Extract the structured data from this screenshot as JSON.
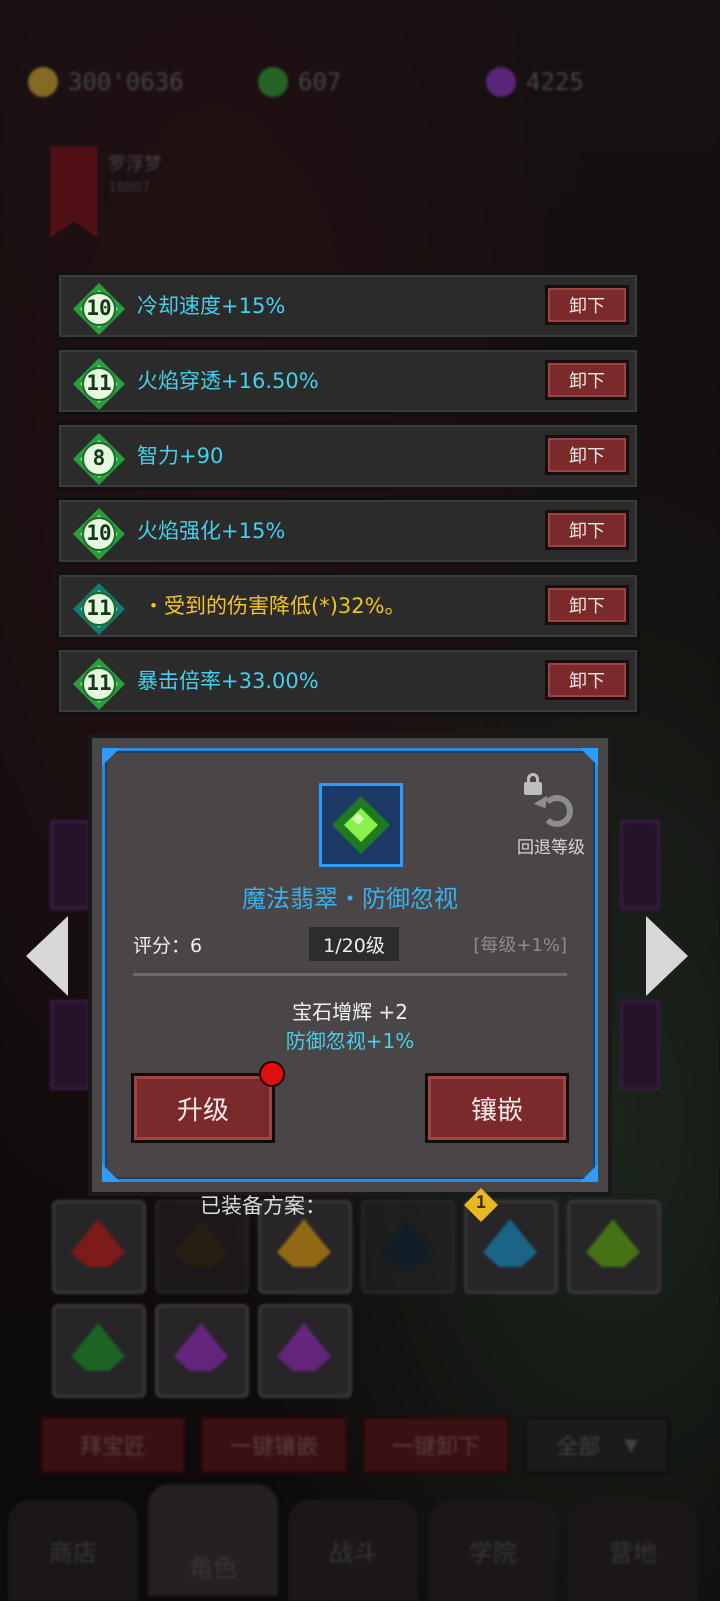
{
  "currencies": [
    {
      "name": "gold-coin-icon",
      "color": "#c9a43a",
      "value": "300'0636"
    },
    {
      "name": "green-crystal-icon",
      "color": "#3a9a3a",
      "value": "607"
    },
    {
      "name": "purple-drop-icon",
      "color": "#8a3ab8",
      "value": "4225"
    }
  ],
  "guild": {
    "name": "罗浮梦",
    "id": "10807"
  },
  "equipped_gems": [
    {
      "level": "10",
      "text": "冷却速度+15%",
      "color": "cyan",
      "unequip": "卸下"
    },
    {
      "level": "11",
      "text": "火焰穿透+16.50%",
      "color": "cyan",
      "unequip": "卸下"
    },
    {
      "level": "8",
      "text": "智力+90",
      "color": "cyan",
      "unequip": "卸下"
    },
    {
      "level": "10",
      "text": "火焰强化+15%",
      "color": "cyan",
      "unequip": "卸下"
    },
    {
      "level": "11",
      "text": "・受到的伤害降低(*)32%。",
      "color": "yellow",
      "unequip": "卸下"
    },
    {
      "level": "11",
      "text": "暴击倍率+33.00%",
      "color": "cyan",
      "unequip": "卸下"
    }
  ],
  "detail": {
    "title": "魔法翡翠・防御忽视",
    "revert_label": "回退等级",
    "score": "评分：6",
    "level": "1/20级",
    "per_level": "[每级+1%]",
    "bonus_name": "宝石增辉 +2",
    "bonus_effect": "防御忽视+1%",
    "upgrade_label": "升级",
    "inlay_label": "镶嵌"
  },
  "plan": {
    "label": "已装备方案：",
    "number": "1"
  },
  "bottom_buttons": [
    "拜宝匠",
    "一键镶嵌",
    "一键卸下",
    "全部"
  ],
  "tabs": [
    "商店",
    "角色",
    "战斗",
    "学院",
    "营地"
  ],
  "colors": {
    "cyan": "#46d0ea",
    "yellow": "#f0c520",
    "panel_border": "#2f9bff",
    "button_red": "#7a2a2a"
  }
}
